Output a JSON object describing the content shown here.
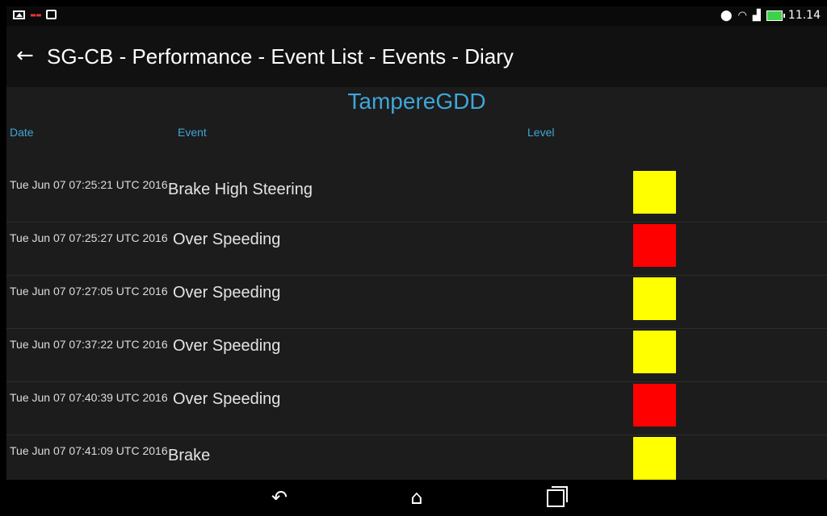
{
  "status_bar": {
    "time": "11.14",
    "left_icons": [
      "image-notification-icon",
      "app-notification-icon",
      "bag-notification-icon"
    ],
    "right_icons": [
      "location-icon",
      "wifi-icon",
      "data-icon",
      "battery-charging-icon"
    ]
  },
  "app_bar": {
    "title": "SG-CB - Performance - Event List - Events - Diary"
  },
  "content": {
    "user_title": "TampereGDD",
    "headers": {
      "date": "Date",
      "event": "Event",
      "level": "Level"
    },
    "level_colors": {
      "yellow": "#ffff00",
      "red": "#ff0000"
    },
    "rows": [
      {
        "date": "Tue Jun 07 07:25:21 UTC 2016",
        "event": "Brake High Steering",
        "level": "yellow"
      },
      {
        "date": "Tue Jun 07 07:25:27 UTC 2016",
        "event": "Over Speeding",
        "level": "red"
      },
      {
        "date": "Tue Jun 07 07:27:05 UTC 2016",
        "event": "Over Speeding",
        "level": "yellow"
      },
      {
        "date": "Tue Jun 07 07:37:22 UTC 2016",
        "event": "Over Speeding",
        "level": "yellow"
      },
      {
        "date": "Tue Jun 07 07:40:39 UTC 2016",
        "event": "Over Speeding",
        "level": "red"
      },
      {
        "date": "Tue Jun 07 07:41:09 UTC 2016",
        "event": "Brake",
        "level": "yellow"
      }
    ]
  },
  "nav_bar": {
    "buttons": [
      "back-icon",
      "home-icon",
      "recents-icon"
    ]
  }
}
